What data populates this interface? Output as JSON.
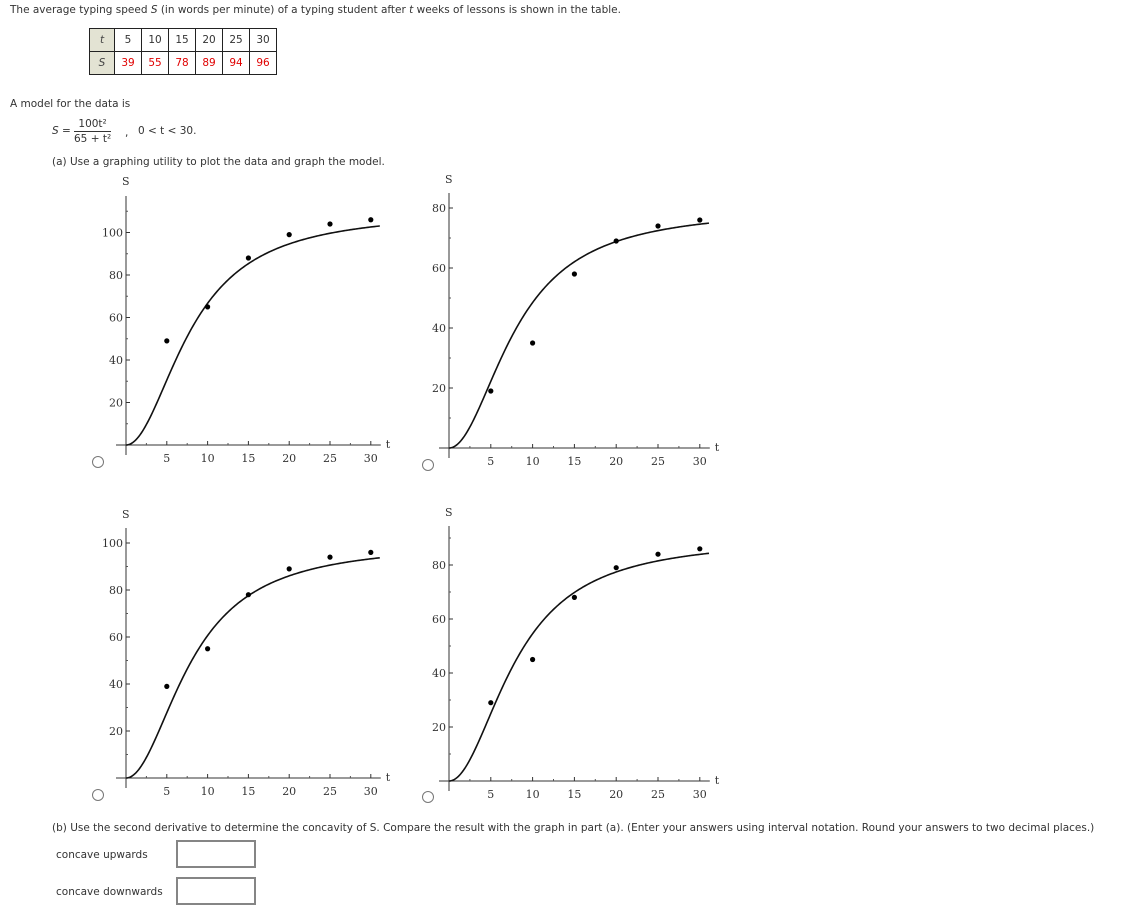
{
  "intro": {
    "pre": "The average typing speed ",
    "var_s": "S",
    "mid": " (in words per minute) of a typing student after ",
    "var_t": "t",
    "post": " weeks of lessons is shown in the table."
  },
  "table": {
    "row_t_label": "t",
    "row_s_label": "S",
    "t": [
      "5",
      "10",
      "15",
      "20",
      "25",
      "30"
    ],
    "s": [
      "39",
      "55",
      "78",
      "89",
      "94",
      "96"
    ],
    "s_color": "#e00000"
  },
  "model": {
    "intro": "A model for the data is",
    "lhs": "S =",
    "numerator": "100t²",
    "denominator": "65 + t²",
    "comma": ",",
    "domain": "0 < t < 30."
  },
  "part_a": {
    "text": "(a) Use a graphing utility to plot the data and graph the model."
  },
  "part_b": {
    "text": "(b) Use the second derivative to determine the concavity of S. Compare the result with the graph in part (a). (Enter your answers using interval notation. Round your answers to two decimal places.)",
    "concave_up_label": "concave upwards",
    "concave_down_label": "concave downwards",
    "concave_up_value": "",
    "concave_down_value": ""
  },
  "chart_data": [
    {
      "type": "scatter",
      "option": "A",
      "title": "",
      "xlabel": "t",
      "ylabel": "S",
      "xlim": [
        0,
        30
      ],
      "ylim": [
        0,
        115
      ],
      "xticks": [
        5,
        10,
        15,
        20,
        25,
        30
      ],
      "yticks": [
        20,
        40,
        60,
        80,
        100
      ],
      "yminor": [
        10,
        30,
        50,
        70,
        90,
        110
      ],
      "points": {
        "x": [
          5,
          10,
          15,
          20,
          25,
          30
        ],
        "y": [
          49,
          65,
          88,
          99,
          104,
          106
        ]
      },
      "curve": {
        "formula": "k*100t^2/(65+t^2)",
        "k": 1.1
      },
      "grid": false,
      "legend": "none"
    },
    {
      "type": "scatter",
      "option": "B",
      "title": "",
      "xlabel": "t",
      "ylabel": "S",
      "xlim": [
        0,
        30
      ],
      "ylim": [
        0,
        85
      ],
      "xticks": [
        5,
        10,
        15,
        20,
        25,
        30
      ],
      "yticks": [
        20,
        40,
        60,
        80
      ],
      "yminor": [
        10,
        30,
        50,
        70
      ],
      "points": {
        "x": [
          5,
          10,
          15,
          20,
          25,
          30
        ],
        "y": [
          19,
          35,
          58,
          69,
          74,
          76
        ]
      },
      "curve": {
        "formula": "k*100t^2/(65+t^2)",
        "k": 0.8
      },
      "grid": false,
      "legend": "none"
    },
    {
      "type": "scatter",
      "option": "C",
      "title": "",
      "xlabel": "t",
      "ylabel": "S",
      "xlim": [
        0,
        30
      ],
      "ylim": [
        0,
        105
      ],
      "xticks": [
        5,
        10,
        15,
        20,
        25,
        30
      ],
      "yticks": [
        20,
        40,
        60,
        80,
        100
      ],
      "yminor": [
        10,
        30,
        50,
        70,
        90
      ],
      "points": {
        "x": [
          5,
          10,
          15,
          20,
          25,
          30
        ],
        "y": [
          39,
          55,
          78,
          89,
          94,
          96
        ]
      },
      "curve": {
        "formula": "k*100t^2/(65+t^2)",
        "k": 1.0
      },
      "grid": false,
      "legend": "none"
    },
    {
      "type": "scatter",
      "option": "D",
      "title": "",
      "xlabel": "t",
      "ylabel": "S",
      "xlim": [
        0,
        30
      ],
      "ylim": [
        0,
        95
      ],
      "xticks": [
        5,
        10,
        15,
        20,
        25,
        30
      ],
      "yticks": [
        20,
        40,
        60,
        80
      ],
      "yminor": [
        10,
        30,
        50,
        70,
        90
      ],
      "points": {
        "x": [
          5,
          10,
          15,
          20,
          25,
          30
        ],
        "y": [
          29,
          45,
          68,
          79,
          84,
          86
        ]
      },
      "curve": {
        "formula": "k*100t^2/(65+t^2)",
        "k": 0.9
      },
      "grid": false,
      "legend": "none"
    }
  ]
}
